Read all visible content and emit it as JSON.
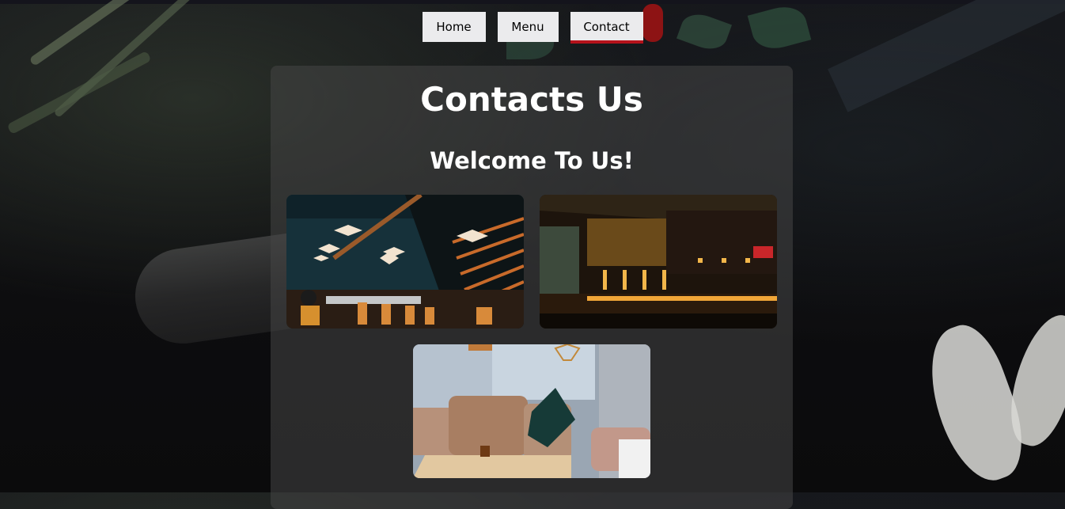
{
  "nav": {
    "items": [
      {
        "label": "Home"
      },
      {
        "label": "Menu"
      },
      {
        "label": "Contact"
      }
    ],
    "active": "Contact",
    "accent_color": "#b5121b"
  },
  "content": {
    "title": "Contacts Us",
    "subtitle": "Welcome To Us!"
  },
  "gallery": {
    "images": [
      {
        "icon": "restaurant-interior-staircase-photo"
      },
      {
        "icon": "bar-counter-night-photo"
      },
      {
        "icon": "cafe-cushion-seat-photo"
      }
    ]
  }
}
